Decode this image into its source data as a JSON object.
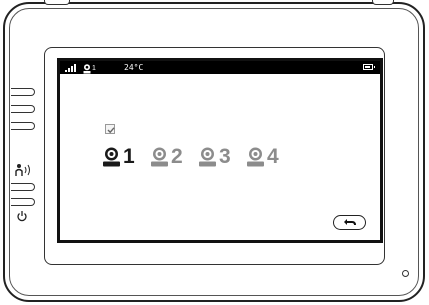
{
  "status_bar": {
    "signal_icon": "signal-strength-icon",
    "camera_icon": "camera-icon",
    "camera_number": "1",
    "temperature": "24°C",
    "battery_icon": "battery-icon",
    "battery_level": 0.8
  },
  "camera_select": {
    "checkbox_icon": "checkmark-icon",
    "checked": true,
    "cameras": [
      {
        "label": "1",
        "selected": true,
        "color": "#1a1a1a"
      },
      {
        "label": "2",
        "selected": false,
        "color": "#8c8c8c"
      },
      {
        "label": "3",
        "selected": false,
        "color": "#8c8c8c"
      },
      {
        "label": "4",
        "selected": false,
        "color": "#8c8c8c"
      }
    ]
  },
  "controls": {
    "back_icon": "back-arrow-icon",
    "side_buttons": [
      "menu-up-button",
      "menu-button",
      "menu-down-button"
    ],
    "talk_icon": "talk-icon",
    "power_icon": "power-icon"
  },
  "colors": {
    "screen_background": "#ffffff",
    "status_bar": "#000000",
    "active_camera": "#1a1a1a",
    "inactive_camera": "#8c8c8c"
  }
}
